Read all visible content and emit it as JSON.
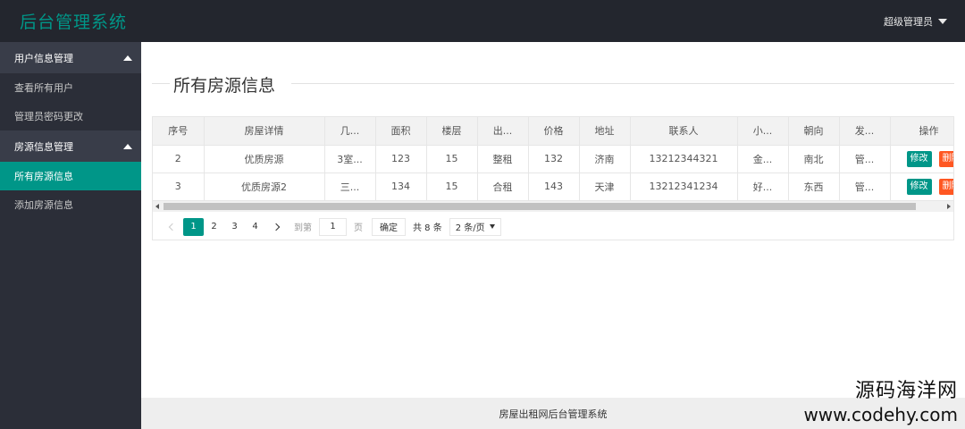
{
  "app": {
    "logo": "后台管理系统",
    "user": "超级管理员"
  },
  "sidebar": {
    "groups": [
      {
        "label": "用户信息管理",
        "items": [
          {
            "label": "查看所有用户"
          },
          {
            "label": "管理员密码更改"
          }
        ]
      },
      {
        "label": "房源信息管理",
        "items": [
          {
            "label": "所有房源信息",
            "active": true
          },
          {
            "label": "添加房源信息"
          }
        ]
      }
    ]
  },
  "main": {
    "title": "所有房源信息"
  },
  "table": {
    "columns": [
      "序号",
      "房屋详情",
      "几...",
      "面积",
      "楼层",
      "出...",
      "价格",
      "地址",
      "联系人",
      "小...",
      "朝向",
      "发...",
      "操作"
    ],
    "rows": [
      [
        "2",
        "优质房源",
        "3室...",
        "123",
        "15",
        "整租",
        "132",
        "济南",
        "13212344321",
        "金...",
        "南北",
        "管..."
      ],
      [
        "3",
        "优质房源2",
        "三...",
        "134",
        "15",
        "合租",
        "143",
        "天津",
        "13212341234",
        "好...",
        "东西",
        "管..."
      ]
    ],
    "edit_label": "修改",
    "delete_label": "删除"
  },
  "pager": {
    "pages": [
      "1",
      "2",
      "3",
      "4"
    ],
    "current": "1",
    "goto_label": "到第",
    "goto_value": "1",
    "page_unit": "页",
    "confirm_label": "确定",
    "total_text": "共 8 条",
    "page_size": "2 条/页"
  },
  "footer": {
    "text": "房屋出租网后台管理系统"
  },
  "watermark": {
    "cn": "源码海洋网",
    "url": "www.codehy.com"
  },
  "colors": {
    "header_bg": "#23262e",
    "sidebar_bg": "#2b2e38",
    "accent": "#009688",
    "danger": "#ff5722"
  }
}
